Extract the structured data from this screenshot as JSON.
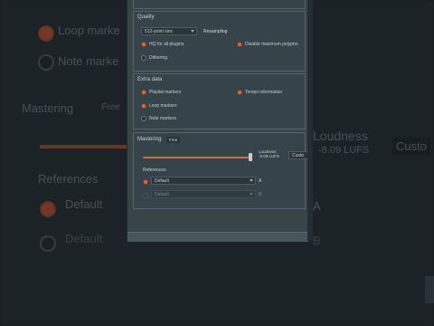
{
  "background": {
    "loop_markers": "Loop marke",
    "note_markers": "Note marke",
    "mastering": "Mastering",
    "free": "Free",
    "loudness": "Loudness",
    "loudness_value": "-8.09 LUFS",
    "custom": "Custo",
    "references": "References",
    "default1": "Default",
    "default2": "Default",
    "a_label": "A",
    "b_label": "B"
  },
  "quality": {
    "title": "Quality",
    "sinc_select": "512-point sinc",
    "resampling": "Resampling",
    "hq_all_plugins": "HQ for all plugins",
    "disable_max_polyphony": "Disable maximum polypho",
    "dithering": "Dithering"
  },
  "extra": {
    "title": "Extra data",
    "playlist_markers": "Playlist markers",
    "tempo_information": "Tempo information",
    "loop_markers": "Loop markers",
    "note_markers": "Note markers"
  },
  "mastering": {
    "title": "Mastering",
    "badge": "Free",
    "loudness_label": "Loudness",
    "loudness_value": "-8.09 LUFS",
    "preset": "Custo",
    "slider_level": 0.98,
    "references_title": "References",
    "ref_a_value": "Default",
    "ref_a_label": "A",
    "ref_b_value": "Default",
    "ref_b_label": "B"
  },
  "colors": {
    "accent": "#e0683f",
    "panel": "#394449",
    "section": "#37434a"
  }
}
